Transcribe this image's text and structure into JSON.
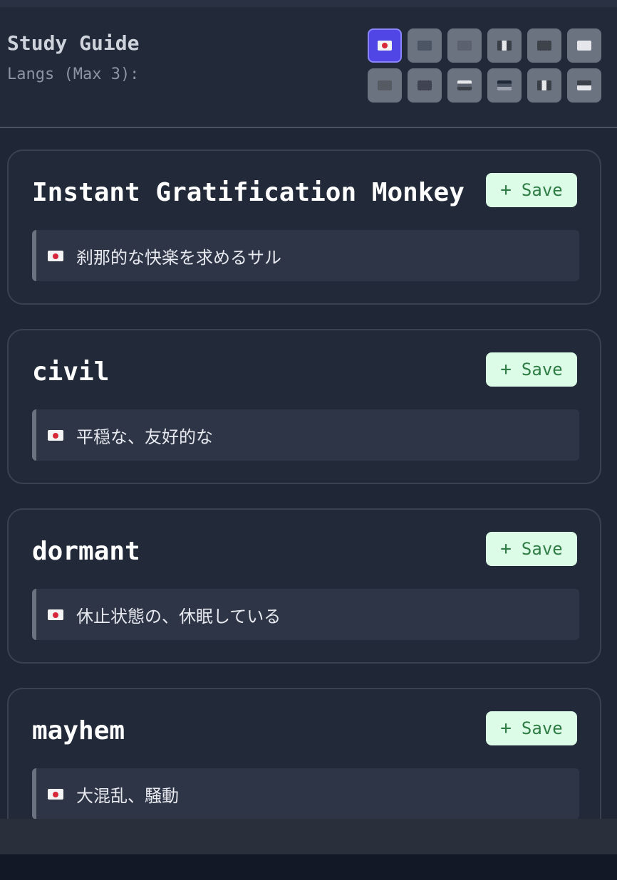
{
  "header": {
    "title": "Study Guide",
    "langs_label": "Langs (Max 3):",
    "flags": [
      {
        "icon": "japan-flag-icon",
        "active": true
      },
      {
        "icon": "uk-flag-icon",
        "active": false
      },
      {
        "icon": "spain-flag-icon",
        "active": false
      },
      {
        "icon": "france-flag-icon",
        "active": false
      },
      {
        "icon": "china-flag-icon",
        "active": false
      },
      {
        "icon": "korea-flag-icon",
        "active": false
      },
      {
        "icon": "brazil-flag-icon",
        "active": false
      },
      {
        "icon": "saudi-flag-icon",
        "active": false
      },
      {
        "icon": "russia-flag-icon",
        "active": false
      },
      {
        "icon": "germany-flag-icon",
        "active": false
      },
      {
        "icon": "italy-flag-icon",
        "active": false
      },
      {
        "icon": "indonesia-flag-icon",
        "active": false
      }
    ]
  },
  "cards": [
    {
      "word": "Instant Gratification Monkey",
      "save_label": "Save",
      "translation": "刹那的な快楽を求めるサル"
    },
    {
      "word": "civil",
      "save_label": "Save",
      "translation": "平穏な、友好的な"
    },
    {
      "word": "dormant",
      "save_label": "Save",
      "translation": "休止状態の、休眠している"
    },
    {
      "word": "mayhem",
      "save_label": "Save",
      "translation": "大混乱、騒動"
    }
  ],
  "colors": {
    "accent": "#4f46e5",
    "save_bg": "#dcfce7",
    "save_text": "#2f7d45"
  }
}
